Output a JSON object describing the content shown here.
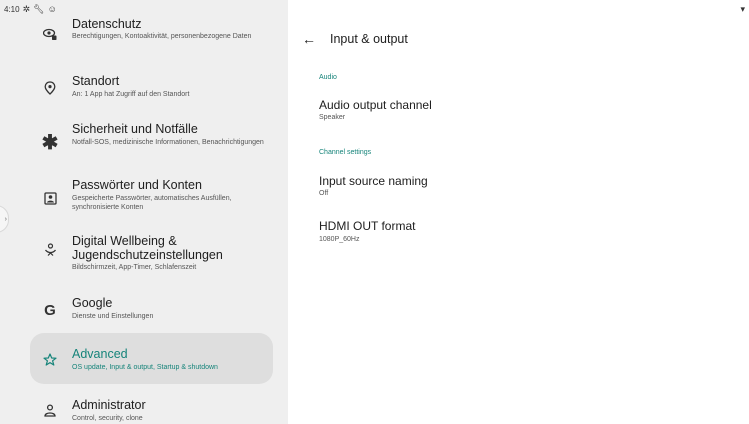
{
  "status": {
    "time": "4:10"
  },
  "left_items": [
    {
      "title": "Datenschutz",
      "sub": "Berechtigungen, Kontoaktivität, personenbezogene Daten",
      "icon": "privacy-icon"
    },
    {
      "title": "Standort",
      "sub": "An: 1 App hat Zugriff auf den Standort",
      "icon": "location-icon"
    },
    {
      "title": "Sicherheit und Notfälle",
      "sub": "Notfall-SOS, medizinische Informationen, Benachrichtigungen",
      "icon": "asterisk-icon"
    },
    {
      "title": "Passwörter und Konten",
      "sub": "Gespeicherte Passwörter, automatisches Ausfüllen, synchronisierte Konten",
      "icon": "account-box-icon"
    },
    {
      "title": "Digital Wellbeing & Jugendschutzeinstellungen",
      "sub": "Bildschirmzeit, App-Timer, Schlafenszeit",
      "icon": "wellbeing-icon"
    },
    {
      "title": "Google",
      "sub": "Dienste und Einstellungen",
      "icon": "google-icon"
    },
    {
      "title": "Advanced",
      "sub": "OS update, Input & output, Startup & shutdown",
      "icon": "star-outline-icon"
    },
    {
      "title": "Administrator",
      "sub": "Control, security, clone",
      "icon": "person-icon"
    }
  ],
  "header": {
    "title": "Input & output"
  },
  "sections": {
    "audio": "Audio",
    "channel_settings": "Channel settings"
  },
  "prefs": {
    "audio_output": {
      "title": "Audio output channel",
      "value": "Speaker"
    },
    "input_naming": {
      "title": "Input source naming",
      "value": "Off"
    },
    "hdmi_out": {
      "title": "HDMI OUT format",
      "value": "1080P_60Hz"
    }
  },
  "colors": {
    "accent": "#16847a",
    "left_bg": "#efefef",
    "active_bg": "#dedede"
  }
}
